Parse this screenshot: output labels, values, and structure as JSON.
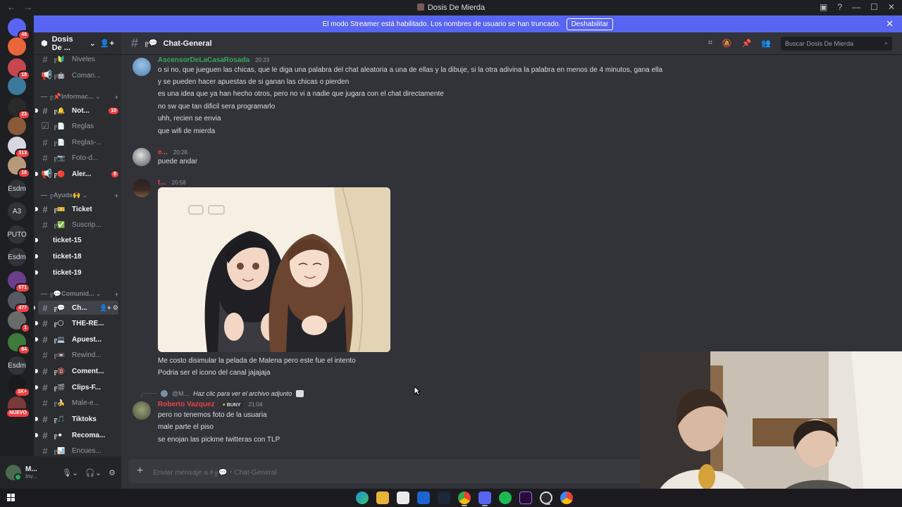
{
  "window": {
    "title": "Dosis De Mierda",
    "back": "←",
    "forward": "→"
  },
  "banner": {
    "text": "El modo Streamer está habilitado. Los nombres de usuario se han truncado.",
    "button": "Deshabilitar",
    "close": "✕"
  },
  "servers": {
    "items": [
      {
        "kind": "icon",
        "color": "#5865f2",
        "badge": "48"
      },
      {
        "kind": "icon",
        "color": "#e8663a",
        "badge": ""
      },
      {
        "kind": "icon",
        "color": "#c7464f",
        "badge": "18"
      },
      {
        "kind": "icon",
        "color": "#3b7a9c",
        "badge": ""
      },
      {
        "kind": "icon",
        "color": "#2a2a2a",
        "badge": "23"
      },
      {
        "kind": "icon",
        "color": "#8a5a3b",
        "badge": ""
      },
      {
        "kind": "icon",
        "color": "#d7d7e2",
        "badge": "313"
      },
      {
        "kind": "icon",
        "color": "#b89a78",
        "badge": "16"
      },
      {
        "kind": "text",
        "label": "Esdm",
        "badge": ""
      },
      {
        "kind": "text",
        "label": "A3",
        "badge": ""
      },
      {
        "kind": "text",
        "label": "PUTO",
        "badge": ""
      },
      {
        "kind": "text",
        "label": "Esdm",
        "badge": ""
      },
      {
        "kind": "icon",
        "color": "#6b3f8c",
        "badge": "671"
      },
      {
        "kind": "icon",
        "color": "#555a63",
        "badge": "477"
      },
      {
        "kind": "icon",
        "color": "#6a6a6a",
        "badge": "1"
      },
      {
        "kind": "icon",
        "color": "#3e7a3a",
        "badge": "84"
      },
      {
        "kind": "text",
        "label": "Esdm",
        "badge": ""
      },
      {
        "kind": "icon",
        "color": "#1a1a1a",
        "badge": "1K+"
      },
      {
        "kind": "icon",
        "color": "#7a3a3a",
        "badge": "NUEVO"
      }
    ]
  },
  "channels": {
    "guild_name": "Dosis De ...",
    "items": [
      {
        "type": "channel",
        "hash": "#",
        "emoji": "╔🔰",
        "label": "Niveles",
        "bold": false
      },
      {
        "type": "channel",
        "hash": "📢",
        "emoji": "╔🤖",
        "label": "Coman...",
        "bold": false
      },
      {
        "type": "category",
        "label": "— ╔📌Informac... ⌄",
        "plus": "+"
      },
      {
        "type": "channel",
        "hash": "#",
        "emoji": "╔🔔",
        "label": "Not...",
        "bold": true,
        "count": "10"
      },
      {
        "type": "channel",
        "hash": "☑",
        "emoji": "╔📄",
        "label": "Reglas",
        "bold": false
      },
      {
        "type": "channel",
        "hash": "#",
        "emoji": "╔📄",
        "label": "Reglas-...",
        "bold": false
      },
      {
        "type": "channel",
        "hash": "#",
        "emoji": "╔📷",
        "label": "Foto-d...",
        "bold": false
      },
      {
        "type": "channel",
        "hash": "📢",
        "emoji": "╔🔴",
        "label": "Aler...",
        "bold": true,
        "count": "8"
      },
      {
        "type": "category",
        "label": "— ╔Ayuda🙌 ⌄",
        "plus": "+"
      },
      {
        "type": "channel",
        "hash": "#",
        "emoji": "╔🎫",
        "label": "Ticket",
        "bold": true
      },
      {
        "type": "channel",
        "hash": "#",
        "emoji": "╔✅",
        "label": "Suscrip...",
        "bold": false
      },
      {
        "type": "channel",
        "hash": "",
        "emoji": "",
        "label": "ticket-15",
        "bold": true
      },
      {
        "type": "channel",
        "hash": "",
        "emoji": "",
        "label": "ticket-18",
        "bold": true
      },
      {
        "type": "channel",
        "hash": "",
        "emoji": "",
        "label": "ticket-19",
        "bold": true
      },
      {
        "type": "category",
        "label": "— ╔💬Comunid... ⌄",
        "plus": "+"
      },
      {
        "type": "channel",
        "hash": "#",
        "emoji": "╔💬",
        "label": "Ch...",
        "bold": true,
        "selected": true,
        "icons": "👤+ ⚙"
      },
      {
        "type": "channel",
        "hash": "#",
        "emoji": "╔🌕",
        "label": "THE-RE...",
        "bold": true
      },
      {
        "type": "channel",
        "hash": "#",
        "emoji": "╔💻",
        "label": "Apuest...",
        "bold": true
      },
      {
        "type": "channel",
        "hash": "#",
        "emoji": "╔📼",
        "label": "Rewind...",
        "bold": false
      },
      {
        "type": "channel",
        "hash": "#",
        "emoji": "╔🔞",
        "label": "Coment...",
        "bold": true
      },
      {
        "type": "channel",
        "hash": "#",
        "emoji": "╔🎬",
        "label": "Clips-F...",
        "bold": true
      },
      {
        "type": "channel",
        "hash": "#",
        "emoji": "╔🍌",
        "label": "Male-e...",
        "bold": false
      },
      {
        "type": "channel",
        "hash": "#",
        "emoji": "╔🎵",
        "label": "Tiktoks",
        "bold": true
      },
      {
        "type": "channel",
        "hash": "#",
        "emoji": "╔⚫",
        "label": "Recoma...",
        "bold": true
      },
      {
        "type": "channel",
        "hash": "#",
        "emoji": "╔📊",
        "label": "Encues...",
        "bold": false
      }
    ]
  },
  "user": {
    "name": "M...",
    "status": "Inv..."
  },
  "header": {
    "channel_emoji": "╔💬",
    "channel_name": "Chat-General",
    "search_placeholder": "Buscar Dosis De Mierda"
  },
  "messages": [
    {
      "author": "AscensorDeLaCasaRosada",
      "author_color": "#3ba55c",
      "time": "20:23",
      "lines": [
        "o si no, que jueguen las chicas, que le diga una palabra del chat aleatoria a una de ellas y la dibuje, si la otra adivina la palabra en menos de 4 minutos, gana ella",
        "y se pueden hacer apuestas de si ganan las chicas o pierden",
        "es una idea que ya han hecho otros, pero no vi a nadie que jugara con el chat directamente",
        "no sw que tan dificil sera programarlo",
        "uhh, recien se envia",
        "que wifi de mierda"
      ]
    },
    {
      "author": "e...",
      "author_color": "#ed4245",
      "time": "20:28",
      "lines": [
        "puede andar"
      ]
    },
    {
      "author": "t...",
      "author_color": "#ed4245",
      "time": "20:58",
      "lines": [
        "Me costo disimular la pelada de Malena pero este fue el intento",
        "Podria ser el icono del canal jajajaja"
      ]
    },
    {
      "reply_mention": "@M...",
      "reply_text": "Haz clic para ver el archivo adjunto",
      "author": "Roberto Vazquez",
      "author_color": "#ed4245",
      "tag": "BUNY",
      "time": "21:04",
      "lines": [
        "pero no tenemos foto de la usuaria",
        "male parte el piso",
        "se enojan las pickme twitteras con TLP"
      ]
    }
  ],
  "composer": {
    "placeholder": "Enviar mensaje a #╔💬・Chat-General"
  }
}
